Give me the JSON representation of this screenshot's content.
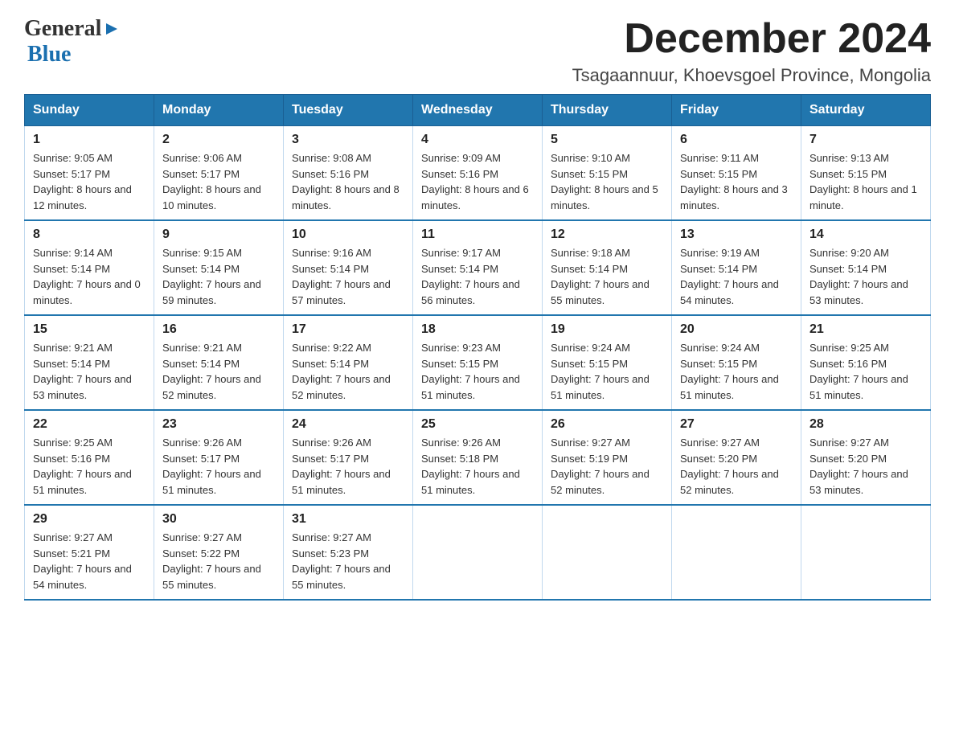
{
  "logo": {
    "general": "General",
    "arrow": "▶",
    "blue": "Blue"
  },
  "title": {
    "month": "December 2024",
    "location": "Tsagaannuur, Khoevsgoel Province, Mongolia"
  },
  "headers": [
    "Sunday",
    "Monday",
    "Tuesday",
    "Wednesday",
    "Thursday",
    "Friday",
    "Saturday"
  ],
  "weeks": [
    [
      {
        "day": "1",
        "sunrise": "9:05 AM",
        "sunset": "5:17 PM",
        "daylight": "8 hours and 12 minutes."
      },
      {
        "day": "2",
        "sunrise": "9:06 AM",
        "sunset": "5:17 PM",
        "daylight": "8 hours and 10 minutes."
      },
      {
        "day": "3",
        "sunrise": "9:08 AM",
        "sunset": "5:16 PM",
        "daylight": "8 hours and 8 minutes."
      },
      {
        "day": "4",
        "sunrise": "9:09 AM",
        "sunset": "5:16 PM",
        "daylight": "8 hours and 6 minutes."
      },
      {
        "day": "5",
        "sunrise": "9:10 AM",
        "sunset": "5:15 PM",
        "daylight": "8 hours and 5 minutes."
      },
      {
        "day": "6",
        "sunrise": "9:11 AM",
        "sunset": "5:15 PM",
        "daylight": "8 hours and 3 minutes."
      },
      {
        "day": "7",
        "sunrise": "9:13 AM",
        "sunset": "5:15 PM",
        "daylight": "8 hours and 1 minute."
      }
    ],
    [
      {
        "day": "8",
        "sunrise": "9:14 AM",
        "sunset": "5:14 PM",
        "daylight": "7 hours and 0 minutes."
      },
      {
        "day": "9",
        "sunrise": "9:15 AM",
        "sunset": "5:14 PM",
        "daylight": "7 hours and 59 minutes."
      },
      {
        "day": "10",
        "sunrise": "9:16 AM",
        "sunset": "5:14 PM",
        "daylight": "7 hours and 57 minutes."
      },
      {
        "day": "11",
        "sunrise": "9:17 AM",
        "sunset": "5:14 PM",
        "daylight": "7 hours and 56 minutes."
      },
      {
        "day": "12",
        "sunrise": "9:18 AM",
        "sunset": "5:14 PM",
        "daylight": "7 hours and 55 minutes."
      },
      {
        "day": "13",
        "sunrise": "9:19 AM",
        "sunset": "5:14 PM",
        "daylight": "7 hours and 54 minutes."
      },
      {
        "day": "14",
        "sunrise": "9:20 AM",
        "sunset": "5:14 PM",
        "daylight": "7 hours and 53 minutes."
      }
    ],
    [
      {
        "day": "15",
        "sunrise": "9:21 AM",
        "sunset": "5:14 PM",
        "daylight": "7 hours and 53 minutes."
      },
      {
        "day": "16",
        "sunrise": "9:21 AM",
        "sunset": "5:14 PM",
        "daylight": "7 hours and 52 minutes."
      },
      {
        "day": "17",
        "sunrise": "9:22 AM",
        "sunset": "5:14 PM",
        "daylight": "7 hours and 52 minutes."
      },
      {
        "day": "18",
        "sunrise": "9:23 AM",
        "sunset": "5:15 PM",
        "daylight": "7 hours and 51 minutes."
      },
      {
        "day": "19",
        "sunrise": "9:24 AM",
        "sunset": "5:15 PM",
        "daylight": "7 hours and 51 minutes."
      },
      {
        "day": "20",
        "sunrise": "9:24 AM",
        "sunset": "5:15 PM",
        "daylight": "7 hours and 51 minutes."
      },
      {
        "day": "21",
        "sunrise": "9:25 AM",
        "sunset": "5:16 PM",
        "daylight": "7 hours and 51 minutes."
      }
    ],
    [
      {
        "day": "22",
        "sunrise": "9:25 AM",
        "sunset": "5:16 PM",
        "daylight": "7 hours and 51 minutes."
      },
      {
        "day": "23",
        "sunrise": "9:26 AM",
        "sunset": "5:17 PM",
        "daylight": "7 hours and 51 minutes."
      },
      {
        "day": "24",
        "sunrise": "9:26 AM",
        "sunset": "5:17 PM",
        "daylight": "7 hours and 51 minutes."
      },
      {
        "day": "25",
        "sunrise": "9:26 AM",
        "sunset": "5:18 PM",
        "daylight": "7 hours and 51 minutes."
      },
      {
        "day": "26",
        "sunrise": "9:27 AM",
        "sunset": "5:19 PM",
        "daylight": "7 hours and 52 minutes."
      },
      {
        "day": "27",
        "sunrise": "9:27 AM",
        "sunset": "5:20 PM",
        "daylight": "7 hours and 52 minutes."
      },
      {
        "day": "28",
        "sunrise": "9:27 AM",
        "sunset": "5:20 PM",
        "daylight": "7 hours and 53 minutes."
      }
    ],
    [
      {
        "day": "29",
        "sunrise": "9:27 AM",
        "sunset": "5:21 PM",
        "daylight": "7 hours and 54 minutes."
      },
      {
        "day": "30",
        "sunrise": "9:27 AM",
        "sunset": "5:22 PM",
        "daylight": "7 hours and 55 minutes."
      },
      {
        "day": "31",
        "sunrise": "9:27 AM",
        "sunset": "5:23 PM",
        "daylight": "7 hours and 55 minutes."
      },
      null,
      null,
      null,
      null
    ]
  ],
  "labels": {
    "sunrise_prefix": "Sunrise: ",
    "sunset_prefix": "Sunset: ",
    "daylight_prefix": "Daylight: "
  }
}
